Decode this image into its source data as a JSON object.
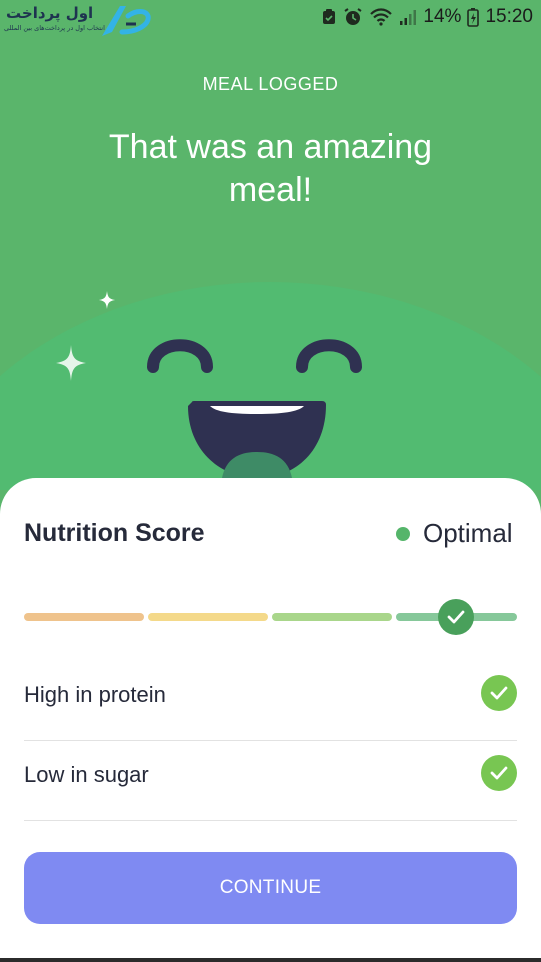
{
  "status_bar": {
    "logo_title": "اول پرداخت",
    "logo_subtitle": "انتخاب اول در پرداخت‌های بین المللی",
    "battery_percent": "14%",
    "time": "15:20"
  },
  "header": {
    "eyebrow": "MEAL LOGGED",
    "headline": "That was an amazing meal!"
  },
  "nutrition": {
    "title": "Nutrition Score",
    "status_label": "Optimal",
    "status_color": "#55b56a",
    "score_segments": [
      "#efc38c",
      "#f4d98a",
      "#a9d68b",
      "#86c89a"
    ],
    "score_level": 4,
    "score_max": 4
  },
  "highlights": [
    {
      "label": "High in protein"
    },
    {
      "label": "Low in sugar"
    }
  ],
  "actions": {
    "continue_label": "CONTINUE"
  },
  "colors": {
    "background": "#5ab56b",
    "mascot": "#52bb71",
    "button": "#7f8af2",
    "check": "#78c652"
  }
}
